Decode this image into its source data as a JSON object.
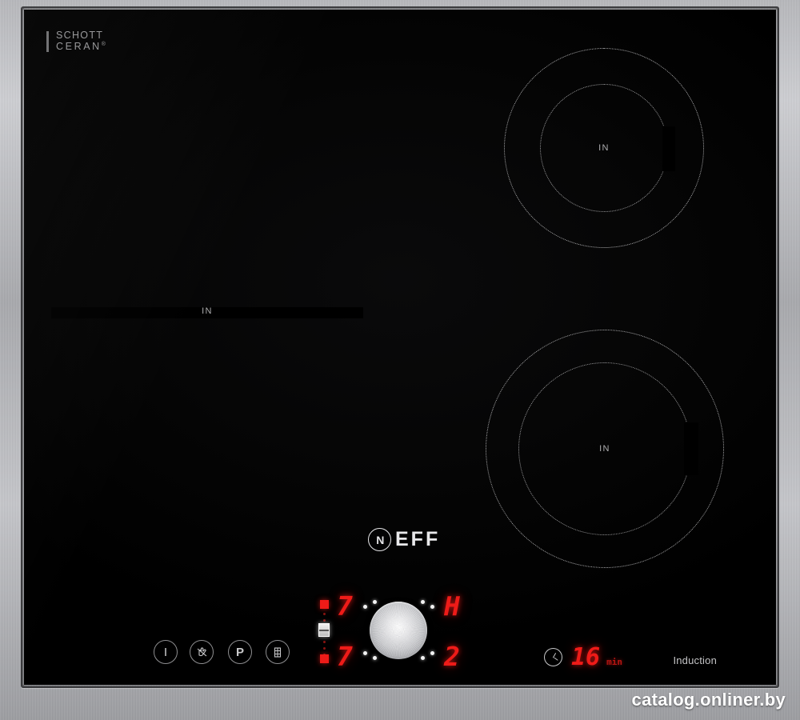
{
  "product": {
    "brand": "NEFF",
    "brand_mark": "N",
    "glass_brand_line1": "SCHOTT",
    "glass_brand_line2": "CERAN",
    "glass_brand_reg": "®",
    "type_label": "Induction"
  },
  "zones": {
    "flex": {
      "label": "IN"
    },
    "rear_right": {
      "label": "IN"
    },
    "front_right": {
      "label": "IN"
    }
  },
  "display": {
    "zone_left_top": "7",
    "zone_left_bottom": "7",
    "zone_right_top": "H",
    "zone_right_bottom": "2"
  },
  "timer": {
    "value": "16",
    "unit": "min",
    "icon": "clock-icon"
  },
  "buttons": [
    {
      "name": "power-button",
      "icon": "power-icon",
      "glyph": "|"
    },
    {
      "name": "child-lock-button",
      "icon": "hand-lock-icon",
      "glyph": ""
    },
    {
      "name": "power-boost-button",
      "icon": "p-boost-icon",
      "glyph": "P"
    },
    {
      "name": "pan-detection-button",
      "icon": "pot-icon",
      "glyph": ""
    }
  ],
  "knob": {
    "name": "twistpad-knob"
  },
  "watermark": "catalog.onliner.by",
  "colors": {
    "glass": "#000000",
    "frame": "#b8b9bd",
    "display_red": "#ee1b18",
    "dot": "#d9d9d9",
    "label_gray": "#aeaeb0"
  }
}
